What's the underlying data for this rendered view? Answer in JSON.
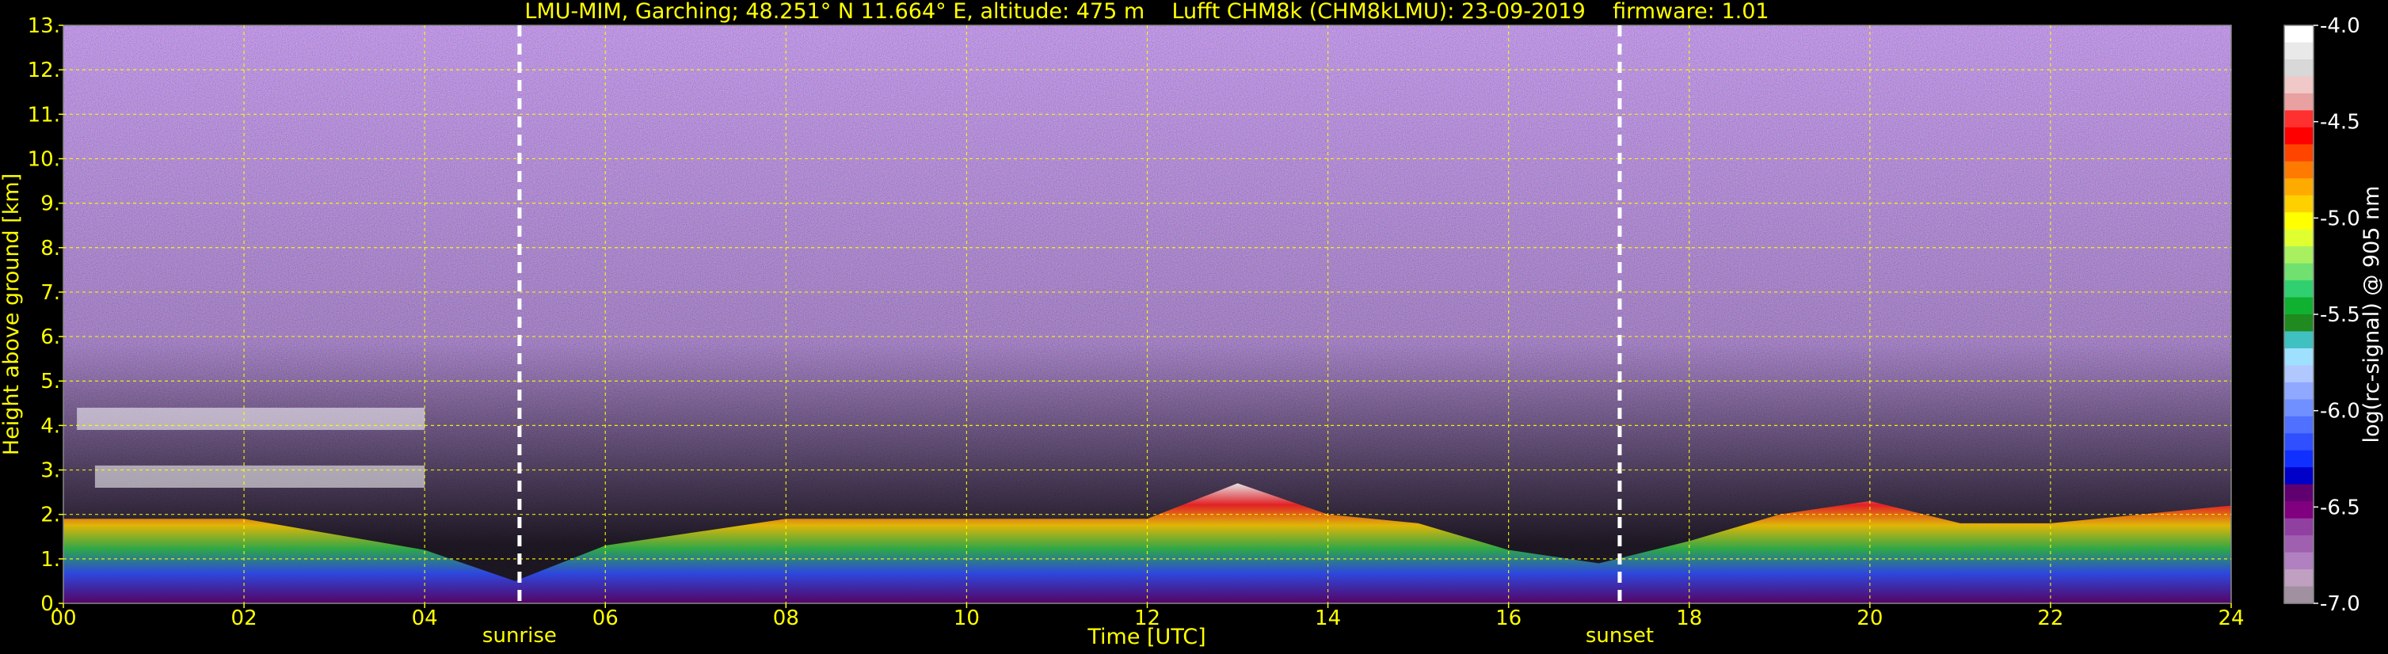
{
  "chart_data": {
    "type": "heatmap",
    "title": "LMU-MIM, Garching; 48.251° N 11.664° E, altitude: 475 m    Lufft CHM8k (CHM8kLMU): 23-09-2019    firmware: 1.01",
    "xlabel": "Time [UTC]",
    "ylabel": "Height above ground [km]",
    "xlim": [
      0,
      24
    ],
    "ylim": [
      0,
      13
    ],
    "x_ticks": [
      "00",
      "02",
      "04",
      "06",
      "08",
      "10",
      "12",
      "14",
      "16",
      "18",
      "20",
      "22",
      "24"
    ],
    "y_ticks": [
      "0.",
      "1.",
      "2.",
      "3.",
      "4.",
      "5.",
      "6.",
      "7.",
      "8.",
      "9.",
      "10.",
      "11.",
      "12.",
      "13."
    ],
    "grid": true,
    "grid_color": "#ffff00",
    "colorbar": {
      "label": "log(rc-signal) @ 905 nm",
      "range": [
        -7.0,
        -4.0
      ],
      "ticks": [
        "-4.0",
        "-4.5",
        "-5.0",
        "-5.5",
        "-6.0",
        "-6.5",
        "-7.0"
      ],
      "colors": [
        "#ffffff",
        "#e9e9e9",
        "#d8d8d8",
        "#f0c8c8",
        "#e8a0a0",
        "#ff3030",
        "#ff0000",
        "#ff4400",
        "#ff7a00",
        "#ffaa00",
        "#ffd000",
        "#ffff00",
        "#e0ff30",
        "#a8f060",
        "#70e070",
        "#30d070",
        "#10b030",
        "#208a20",
        "#40c0c0",
        "#a0e0ff",
        "#b0c8ff",
        "#90a8ff",
        "#7090ff",
        "#5070ff",
        "#3050ff",
        "#1030ff",
        "#0000c8",
        "#600070",
        "#800080",
        "#9040a0",
        "#a060b0",
        "#b080c0",
        "#c0a0c0",
        "#a090a0"
      ]
    },
    "markers": [
      {
        "label": "sunrise",
        "x": 5.05
      },
      {
        "label": "sunset",
        "x": 17.23
      }
    ],
    "features": {
      "background_noise_color": "#4a3a6a",
      "elevated_layer_km": [
        {
          "x": [
            0.15,
            4.0
          ],
          "y": [
            3.9,
            4.4
          ]
        },
        {
          "x": [
            0.35,
            4.0
          ],
          "y": [
            2.6,
            3.1
          ]
        }
      ],
      "boundary_layer_top_km": {
        "x": [
          0,
          2,
          4,
          5,
          6,
          8,
          10,
          12,
          13,
          14,
          15,
          16,
          17,
          18,
          19,
          20,
          21,
          22,
          23,
          24
        ],
        "y": [
          1.9,
          1.9,
          1.2,
          0.5,
          1.3,
          1.9,
          1.9,
          1.9,
          2.7,
          2.0,
          1.8,
          1.2,
          0.9,
          1.4,
          2.0,
          2.3,
          1.8,
          1.8,
          2.0,
          2.2
        ]
      }
    }
  }
}
